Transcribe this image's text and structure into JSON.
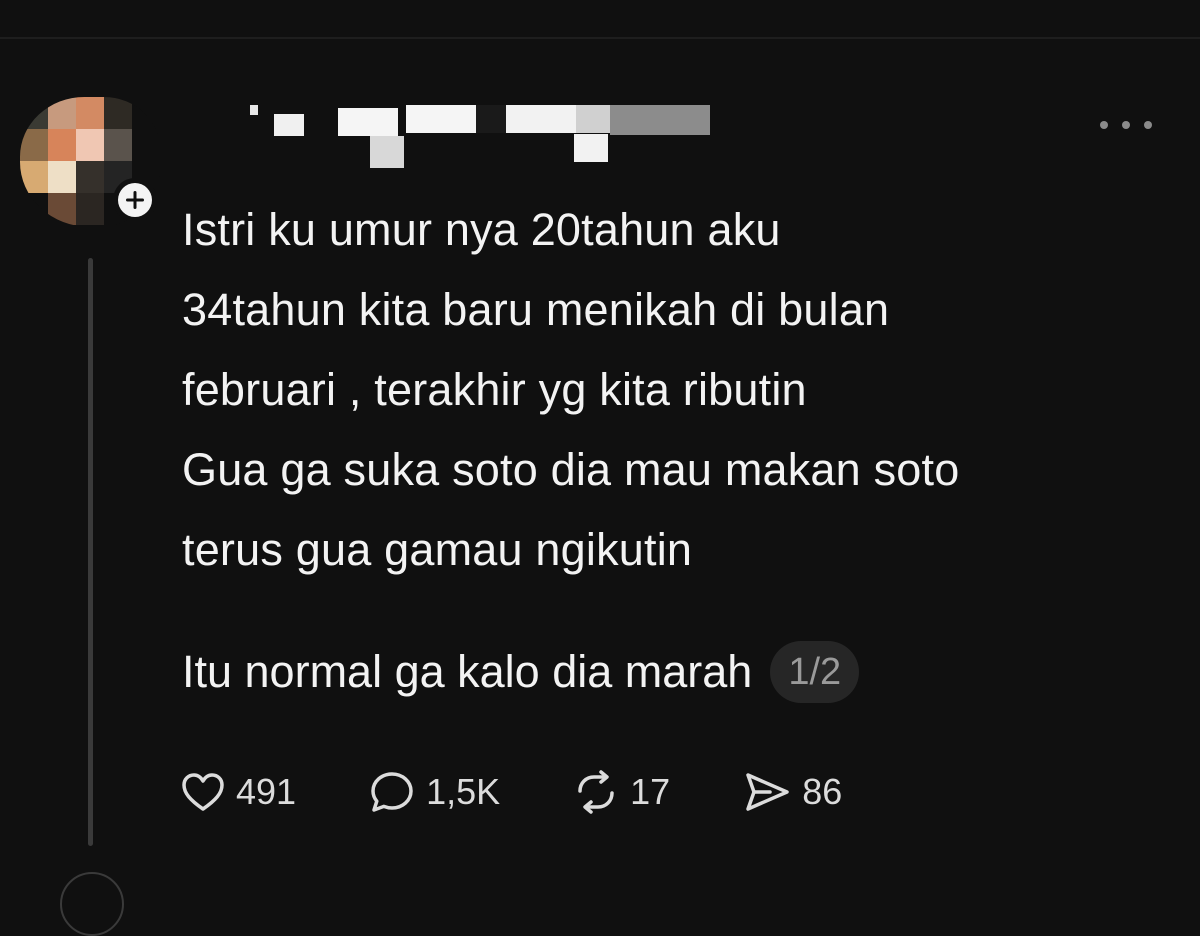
{
  "post": {
    "lines": [
      "Istri ku umur nya 20tahun aku",
      "34tahun kita baru menikah di bulan",
      "februari , terakhir yg kita ributin",
      "Gua ga suka soto dia mau makan soto",
      "terus gua gamau ngikutin"
    ],
    "last_line": "Itu normal ga kalo dia marah",
    "page_indicator": "1/2"
  },
  "actions": {
    "likes": "491",
    "replies": "1,5K",
    "reposts": "17",
    "shares": "86"
  },
  "icons": {
    "more": "more-horizontal-icon",
    "like": "heart-icon",
    "reply": "speech-bubble-icon",
    "repost": "repost-arrows-icon",
    "share": "send-arrow-icon",
    "follow": "plus-icon"
  },
  "colors": {
    "background": "#101010",
    "text": "#f3f3f3",
    "muted": "#9a9a9a",
    "badge_bg": "#262626"
  }
}
